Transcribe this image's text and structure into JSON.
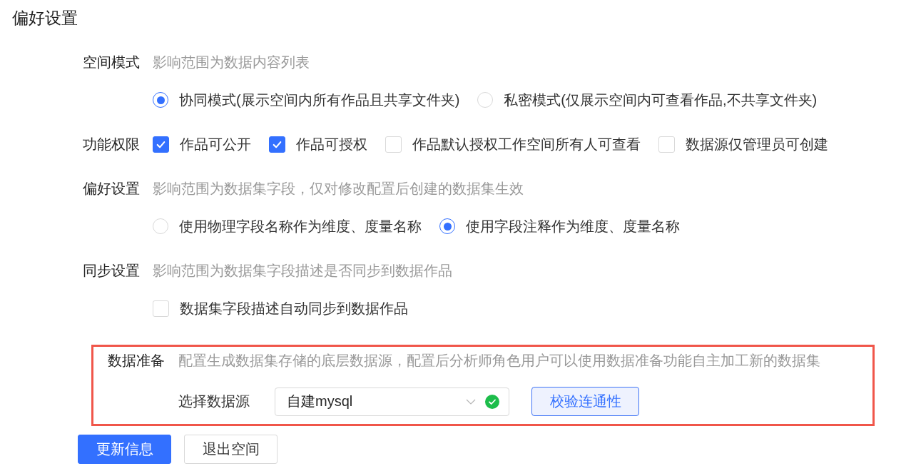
{
  "title": "偏好设置",
  "sections": [
    {
      "kind": "radio",
      "label": "空间模式",
      "hint": "影响范围为数据内容列表",
      "options": [
        {
          "label": "协同模式(展示空间内所有作品且共享文件夹)",
          "selected": true
        },
        {
          "label": "私密模式(仅展示空间内可查看作品,不共享文件夹)",
          "selected": false
        }
      ]
    },
    {
      "kind": "checkbox",
      "label": "功能权限",
      "options": [
        {
          "label": "作品可公开",
          "checked": true
        },
        {
          "label": "作品可授权",
          "checked": true
        },
        {
          "label": "作品默认授权工作空间所有人可查看",
          "checked": false
        },
        {
          "label": "数据源仅管理员可创建",
          "checked": false
        }
      ]
    },
    {
      "kind": "radio",
      "label": "偏好设置",
      "hint": "影响范围为数据集字段，仅对修改配置后创建的数据集生效",
      "options": [
        {
          "label": "使用物理字段名称作为维度、度量名称",
          "selected": false
        },
        {
          "label": "使用字段注释作为维度、度量名称",
          "selected": true
        }
      ]
    },
    {
      "kind": "checkbox",
      "label": "同步设置",
      "hint": "影响范围为数据集字段描述是否同步到数据作品",
      "options": [
        {
          "label": "数据集字段描述自动同步到数据作品",
          "checked": false
        }
      ]
    }
  ],
  "data_prep": {
    "label": "数据准备",
    "hint": "配置生成数据集存储的底层数据源，配置后分析师角色用户可以使用数据准备功能自主加工新的数据集",
    "field_label": "选择数据源",
    "select": {
      "value": "自建mysql",
      "verified": true
    },
    "test_button": "校验连通性"
  },
  "buttons": [
    {
      "label": "更新信息",
      "kind": "primary"
    },
    {
      "label": "退出空间",
      "kind": "default"
    }
  ]
}
